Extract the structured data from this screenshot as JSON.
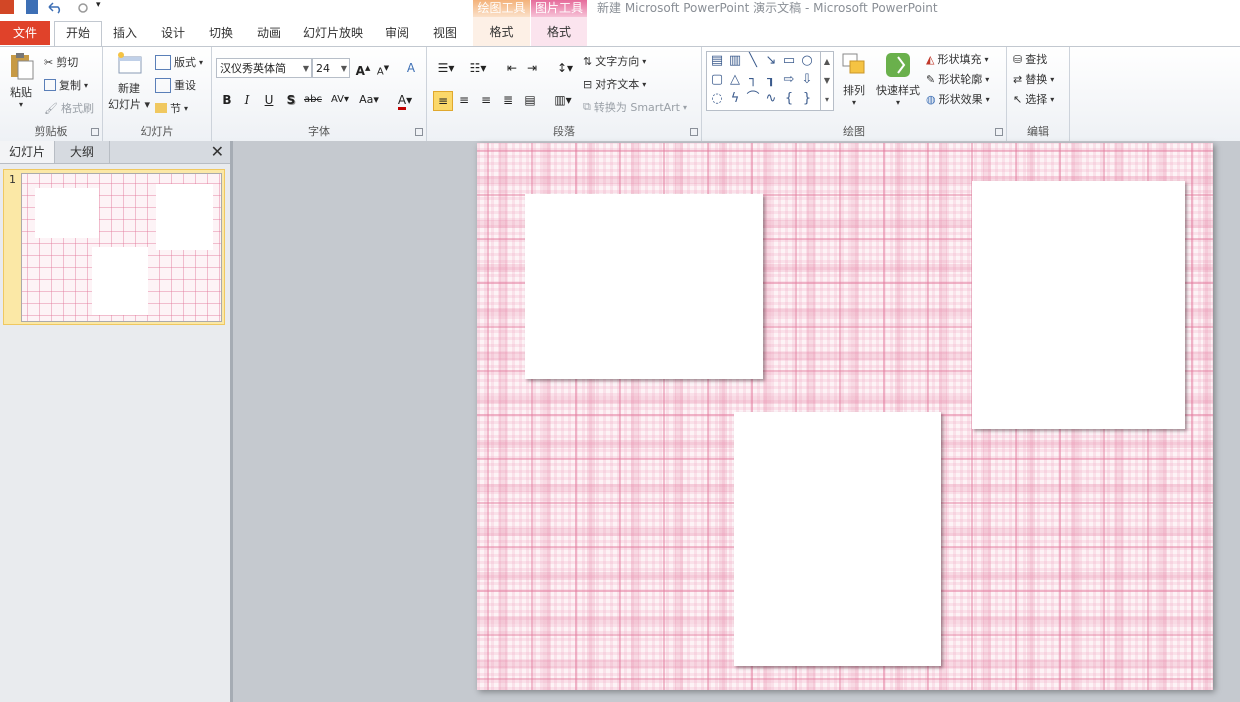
{
  "titlebar": {
    "context_drawing_tools": "绘图工具",
    "context_picture_tools": "图片工具",
    "title": "新建 Microsoft PowerPoint 演示文稿 - Microsoft PowerPoint"
  },
  "tabs": [
    "文件",
    "开始",
    "插入",
    "设计",
    "切换",
    "动画",
    "幻灯片放映",
    "审阅",
    "视图",
    "格式",
    "格式"
  ],
  "ribbon": {
    "clipboard": {
      "paste": "粘贴",
      "cut": "剪切",
      "copy": "复制",
      "format_painter": "格式刷",
      "label": "剪贴板"
    },
    "slides": {
      "new_slide_1": "新建",
      "new_slide_2": "幻灯片",
      "layout": "版式",
      "reset": "重设",
      "section": "节",
      "label": "幻灯片"
    },
    "font": {
      "font_name": "汉仪秀英体简",
      "font_size": "24",
      "label": "字体"
    },
    "paragraph": {
      "text_direction": "文字方向",
      "align_text": "对齐文本",
      "convert_smartart": "转换为 SmartArt",
      "label": "段落"
    },
    "drawing": {
      "arrange": "排列",
      "quick_styles": "快速样式",
      "shape_fill": "形状填充",
      "shape_outline": "形状轮廓",
      "shape_effects": "形状效果",
      "label": "绘图"
    },
    "editing": {
      "find": "查找",
      "replace": "替换",
      "select": "选择",
      "label": "编辑"
    }
  },
  "leftpane": {
    "tab_slides": "幻灯片",
    "tab_outline": "大纲",
    "close": "✕",
    "slide_number": "1"
  },
  "colors": {
    "file_tab": "#e0422a",
    "accent_pink": "#e2789b",
    "selection": "#fbe8a6"
  }
}
